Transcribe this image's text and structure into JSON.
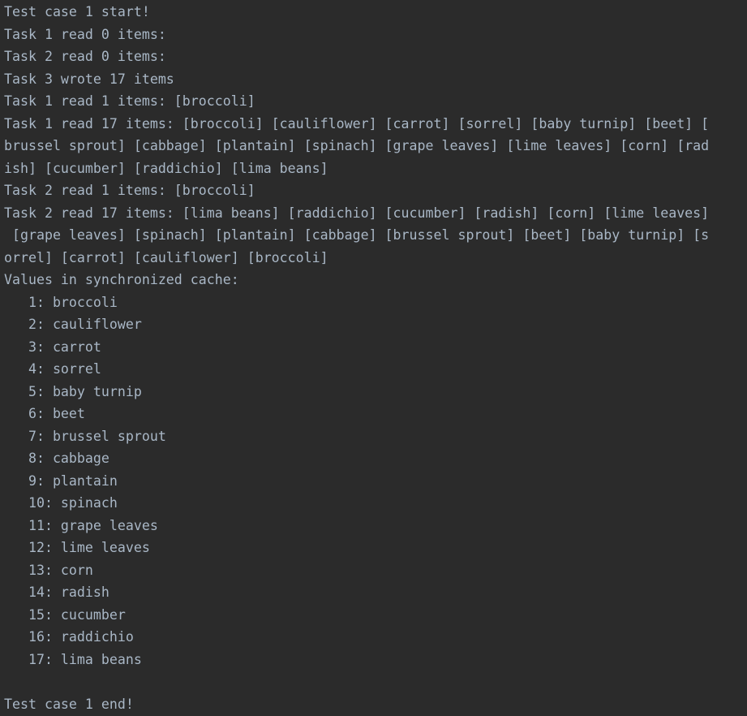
{
  "colors": {
    "background": "#2b2b2b",
    "text": "#a9b7c6"
  },
  "console": {
    "lines": [
      "Test case 1 start!",
      "Task 1 read 0 items:",
      "Task 2 read 0 items:",
      "Task 3 wrote 17 items",
      "Task 1 read 1 items: [broccoli]",
      "Task 1 read 17 items: [broccoli] [cauliflower] [carrot] [sorrel] [baby turnip] [beet] [",
      "brussel sprout] [cabbage] [plantain] [spinach] [grape leaves] [lime leaves] [corn] [rad",
      "ish] [cucumber] [raddichio] [lima beans]",
      "Task 2 read 1 items: [broccoli]",
      "Task 2 read 17 items: [lima beans] [raddichio] [cucumber] [radish] [corn] [lime leaves]",
      " [grape leaves] [spinach] [plantain] [cabbage] [brussel sprout] [beet] [baby turnip] [s",
      "orrel] [carrot] [cauliflower] [broccoli]",
      "Values in synchronized cache:",
      "   1: broccoli",
      "   2: cauliflower",
      "   3: carrot",
      "   4: sorrel",
      "   5: baby turnip",
      "   6: beet",
      "   7: brussel sprout",
      "   8: cabbage",
      "   9: plantain",
      "   10: spinach",
      "   11: grape leaves",
      "   12: lime leaves",
      "   13: corn",
      "   14: radish",
      "   15: cucumber",
      "   16: raddichio",
      "   17: lima beans",
      "",
      "Test case 1 end!"
    ]
  }
}
